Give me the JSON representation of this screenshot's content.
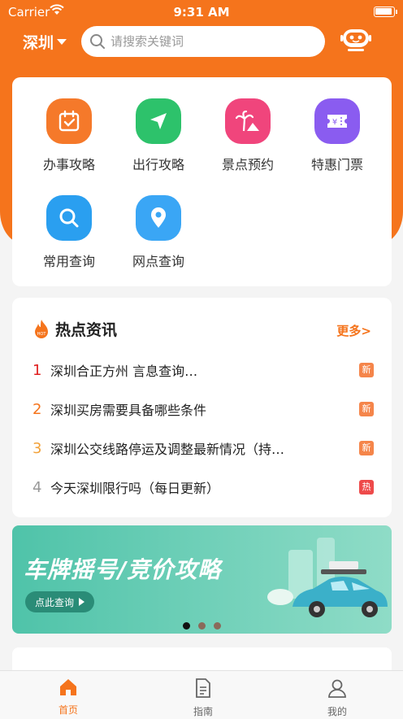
{
  "status_bar": {
    "carrier": "Carrier",
    "time": "9:31 AM"
  },
  "header": {
    "city": "深圳",
    "search_placeholder": "请搜索关键词"
  },
  "quick_links": [
    {
      "label": "办事攻略",
      "icon": "calendar-check-icon",
      "color": "#f5792a"
    },
    {
      "label": "出行攻略",
      "icon": "navigation-arrow-icon",
      "color": "#2dc26b"
    },
    {
      "label": "景点预约",
      "icon": "palm-tree-icon",
      "color": "#f0457c"
    },
    {
      "label": "特惠门票",
      "icon": "ticket-icon",
      "color": "#8a5cf0"
    },
    {
      "label": "常用查询",
      "icon": "magnifier-icon",
      "color": "#2a9ff0"
    },
    {
      "label": "网点查询",
      "icon": "location-pin-icon",
      "color": "#3aa6f5"
    }
  ],
  "news": {
    "title": "热点资讯",
    "more": "更多>",
    "items": [
      {
        "num": "1",
        "text": "深圳合正方州                 言息查询…",
        "badge": "新",
        "num_color": "#e02020",
        "badge_color": "#f5854a"
      },
      {
        "num": "2",
        "text": "深圳买房需要具备哪些条件",
        "badge": "新",
        "num_color": "#f5741c",
        "badge_color": "#f5854a"
      },
      {
        "num": "3",
        "text": "深圳公交线路停运及调整最新情况（持…",
        "badge": "新",
        "num_color": "#f2a23a",
        "badge_color": "#f5854a"
      },
      {
        "num": "4",
        "text": "今天深圳限行吗（每日更新）",
        "badge": "热",
        "num_color": "#999999",
        "badge_color": "#ee4a4a"
      }
    ]
  },
  "banner": {
    "title": "车牌摇号/竞价攻略",
    "button": "点此查询",
    "active_slide": 1,
    "slide_count": 3
  },
  "tabbar": [
    {
      "label": "首页",
      "icon": "home-icon",
      "active": true
    },
    {
      "label": "指南",
      "icon": "document-icon",
      "active": false
    },
    {
      "label": "我的",
      "icon": "profile-icon",
      "active": false
    }
  ]
}
